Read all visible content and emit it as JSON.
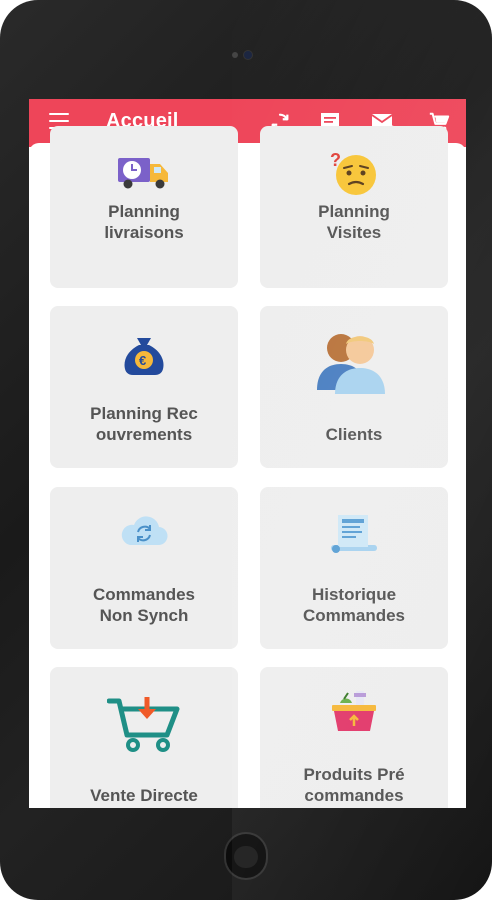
{
  "app": {
    "title": "Accueil",
    "accent_color": "#ee4559",
    "actions": [
      {
        "icon": "sync-icon"
      },
      {
        "icon": "message-icon"
      },
      {
        "icon": "mail-forward-icon"
      },
      {
        "icon": "cart-icon"
      }
    ]
  },
  "tiles": [
    {
      "line1": "Planning",
      "line2": "livraisons",
      "icon": "delivery-truck-icon"
    },
    {
      "line1": "Planning",
      "line2": "Visites",
      "icon": "confused-face-icon"
    },
    {
      "line1": "Planning Rec",
      "line2": "ouvrements",
      "icon": "euro-money-bag-icon"
    },
    {
      "line1": "",
      "line2": "Clients",
      "icon": "clients-icon"
    },
    {
      "line1": "Commandes",
      "line2": "Non Synch",
      "icon": "cloud-sync-icon"
    },
    {
      "line1": "Historique",
      "line2": "Commandes",
      "icon": "receipt-history-icon"
    },
    {
      "line1": "",
      "line2": "Vente Directe",
      "icon": "cart-add-icon"
    },
    {
      "line1": "Produits Pré",
      "line2": "commandes",
      "icon": "grocery-basket-icon"
    }
  ]
}
